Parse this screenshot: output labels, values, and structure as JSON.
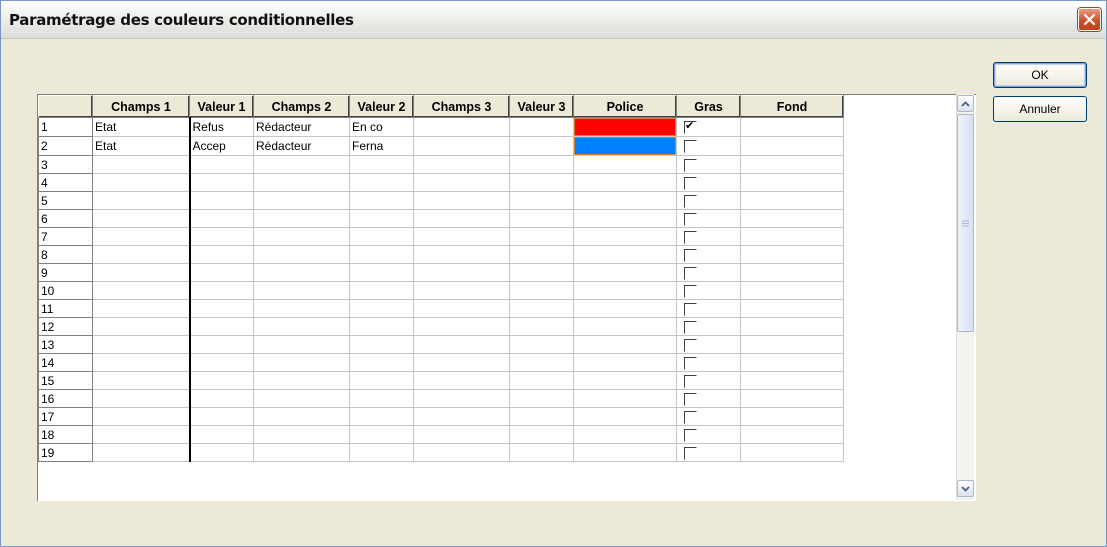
{
  "window": {
    "title": "Paramétrage des couleurs conditionnelles"
  },
  "buttons": {
    "ok": "OK",
    "cancel": "Annuler"
  },
  "grid": {
    "columns": [
      "",
      "Champs 1",
      "Valeur 1",
      "Champs 2",
      "Valeur 2",
      "Champs 3",
      "Valeur 3",
      "Police",
      "Gras",
      "Fond"
    ],
    "rows": [
      {
        "num": "1",
        "champs1": "Etat",
        "valeur1": "Refus",
        "champs2": "Rédacteur",
        "valeur2": "En co",
        "champs3": "",
        "valeur3": "",
        "police_color": "#ff0000",
        "gras": true,
        "fond": ""
      },
      {
        "num": "2",
        "champs1": "Etat",
        "valeur1": "Accep",
        "champs2": "Rédacteur",
        "valeur2": "Ferna",
        "champs3": "",
        "valeur3": "",
        "police_color": "#0080ff",
        "gras": false,
        "fond": ""
      },
      {
        "num": "3",
        "champs1": "",
        "valeur1": "",
        "champs2": "",
        "valeur2": "",
        "champs3": "",
        "valeur3": "",
        "police_color": "",
        "gras": false,
        "fond": ""
      },
      {
        "num": "4",
        "champs1": "",
        "valeur1": "",
        "champs2": "",
        "valeur2": "",
        "champs3": "",
        "valeur3": "",
        "police_color": "",
        "gras": false,
        "fond": ""
      },
      {
        "num": "5",
        "champs1": "",
        "valeur1": "",
        "champs2": "",
        "valeur2": "",
        "champs3": "",
        "valeur3": "",
        "police_color": "",
        "gras": false,
        "fond": ""
      },
      {
        "num": "6",
        "champs1": "",
        "valeur1": "",
        "champs2": "",
        "valeur2": "",
        "champs3": "",
        "valeur3": "",
        "police_color": "",
        "gras": false,
        "fond": ""
      },
      {
        "num": "7",
        "champs1": "",
        "valeur1": "",
        "champs2": "",
        "valeur2": "",
        "champs3": "",
        "valeur3": "",
        "police_color": "",
        "gras": false,
        "fond": ""
      },
      {
        "num": "8",
        "champs1": "",
        "valeur1": "",
        "champs2": "",
        "valeur2": "",
        "champs3": "",
        "valeur3": "",
        "police_color": "",
        "gras": false,
        "fond": ""
      },
      {
        "num": "9",
        "champs1": "",
        "valeur1": "",
        "champs2": "",
        "valeur2": "",
        "champs3": "",
        "valeur3": "",
        "police_color": "",
        "gras": false,
        "fond": ""
      },
      {
        "num": "10",
        "champs1": "",
        "valeur1": "",
        "champs2": "",
        "valeur2": "",
        "champs3": "",
        "valeur3": "",
        "police_color": "",
        "gras": false,
        "fond": ""
      },
      {
        "num": "11",
        "champs1": "",
        "valeur1": "",
        "champs2": "",
        "valeur2": "",
        "champs3": "",
        "valeur3": "",
        "police_color": "",
        "gras": false,
        "fond": ""
      },
      {
        "num": "12",
        "champs1": "",
        "valeur1": "",
        "champs2": "",
        "valeur2": "",
        "champs3": "",
        "valeur3": "",
        "police_color": "",
        "gras": false,
        "fond": ""
      },
      {
        "num": "13",
        "champs1": "",
        "valeur1": "",
        "champs2": "",
        "valeur2": "",
        "champs3": "",
        "valeur3": "",
        "police_color": "",
        "gras": false,
        "fond": ""
      },
      {
        "num": "14",
        "champs1": "",
        "valeur1": "",
        "champs2": "",
        "valeur2": "",
        "champs3": "",
        "valeur3": "",
        "police_color": "",
        "gras": false,
        "fond": ""
      },
      {
        "num": "15",
        "champs1": "",
        "valeur1": "",
        "champs2": "",
        "valeur2": "",
        "champs3": "",
        "valeur3": "",
        "police_color": "",
        "gras": false,
        "fond": ""
      },
      {
        "num": "16",
        "champs1": "",
        "valeur1": "",
        "champs2": "",
        "valeur2": "",
        "champs3": "",
        "valeur3": "",
        "police_color": "",
        "gras": false,
        "fond": ""
      },
      {
        "num": "17",
        "champs1": "",
        "valeur1": "",
        "champs2": "",
        "valeur2": "",
        "champs3": "",
        "valeur3": "",
        "police_color": "",
        "gras": false,
        "fond": ""
      },
      {
        "num": "18",
        "champs1": "",
        "valeur1": "",
        "champs2": "",
        "valeur2": "",
        "champs3": "",
        "valeur3": "",
        "police_color": "",
        "gras": false,
        "fond": ""
      },
      {
        "num": "19",
        "champs1": "",
        "valeur1": "",
        "champs2": "",
        "valeur2": "",
        "champs3": "",
        "valeur3": "",
        "police_color": "",
        "gras": false,
        "fond": ""
      }
    ]
  },
  "icons": {
    "close": "close-icon",
    "scroll_up": "chevron-up-icon",
    "scroll_down": "chevron-down-icon",
    "checkmark": "checkmark-icon"
  },
  "colors": {
    "close_button": "#d0502a",
    "window_border": "#7a96c8",
    "dialog_bg": "#ece9d8"
  }
}
